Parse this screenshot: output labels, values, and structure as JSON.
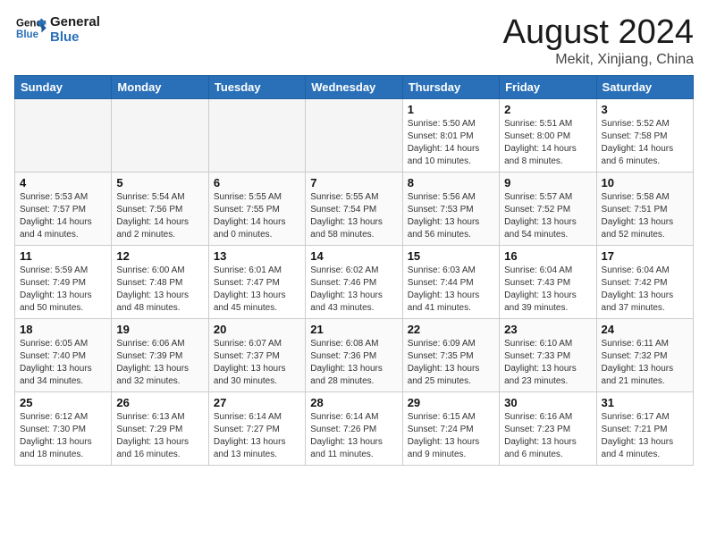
{
  "logo": {
    "line1": "General",
    "line2": "Blue"
  },
  "title": "August 2024",
  "subtitle": "Mekit, Xinjiang, China",
  "headers": [
    "Sunday",
    "Monday",
    "Tuesday",
    "Wednesday",
    "Thursday",
    "Friday",
    "Saturday"
  ],
  "weeks": [
    [
      {
        "day": "",
        "info": ""
      },
      {
        "day": "",
        "info": ""
      },
      {
        "day": "",
        "info": ""
      },
      {
        "day": "",
        "info": ""
      },
      {
        "day": "1",
        "info": "Sunrise: 5:50 AM\nSunset: 8:01 PM\nDaylight: 14 hours\nand 10 minutes."
      },
      {
        "day": "2",
        "info": "Sunrise: 5:51 AM\nSunset: 8:00 PM\nDaylight: 14 hours\nand 8 minutes."
      },
      {
        "day": "3",
        "info": "Sunrise: 5:52 AM\nSunset: 7:58 PM\nDaylight: 14 hours\nand 6 minutes."
      }
    ],
    [
      {
        "day": "4",
        "info": "Sunrise: 5:53 AM\nSunset: 7:57 PM\nDaylight: 14 hours\nand 4 minutes."
      },
      {
        "day": "5",
        "info": "Sunrise: 5:54 AM\nSunset: 7:56 PM\nDaylight: 14 hours\nand 2 minutes."
      },
      {
        "day": "6",
        "info": "Sunrise: 5:55 AM\nSunset: 7:55 PM\nDaylight: 14 hours\nand 0 minutes."
      },
      {
        "day": "7",
        "info": "Sunrise: 5:55 AM\nSunset: 7:54 PM\nDaylight: 13 hours\nand 58 minutes."
      },
      {
        "day": "8",
        "info": "Sunrise: 5:56 AM\nSunset: 7:53 PM\nDaylight: 13 hours\nand 56 minutes."
      },
      {
        "day": "9",
        "info": "Sunrise: 5:57 AM\nSunset: 7:52 PM\nDaylight: 13 hours\nand 54 minutes."
      },
      {
        "day": "10",
        "info": "Sunrise: 5:58 AM\nSunset: 7:51 PM\nDaylight: 13 hours\nand 52 minutes."
      }
    ],
    [
      {
        "day": "11",
        "info": "Sunrise: 5:59 AM\nSunset: 7:49 PM\nDaylight: 13 hours\nand 50 minutes."
      },
      {
        "day": "12",
        "info": "Sunrise: 6:00 AM\nSunset: 7:48 PM\nDaylight: 13 hours\nand 48 minutes."
      },
      {
        "day": "13",
        "info": "Sunrise: 6:01 AM\nSunset: 7:47 PM\nDaylight: 13 hours\nand 45 minutes."
      },
      {
        "day": "14",
        "info": "Sunrise: 6:02 AM\nSunset: 7:46 PM\nDaylight: 13 hours\nand 43 minutes."
      },
      {
        "day": "15",
        "info": "Sunrise: 6:03 AM\nSunset: 7:44 PM\nDaylight: 13 hours\nand 41 minutes."
      },
      {
        "day": "16",
        "info": "Sunrise: 6:04 AM\nSunset: 7:43 PM\nDaylight: 13 hours\nand 39 minutes."
      },
      {
        "day": "17",
        "info": "Sunrise: 6:04 AM\nSunset: 7:42 PM\nDaylight: 13 hours\nand 37 minutes."
      }
    ],
    [
      {
        "day": "18",
        "info": "Sunrise: 6:05 AM\nSunset: 7:40 PM\nDaylight: 13 hours\nand 34 minutes."
      },
      {
        "day": "19",
        "info": "Sunrise: 6:06 AM\nSunset: 7:39 PM\nDaylight: 13 hours\nand 32 minutes."
      },
      {
        "day": "20",
        "info": "Sunrise: 6:07 AM\nSunset: 7:37 PM\nDaylight: 13 hours\nand 30 minutes."
      },
      {
        "day": "21",
        "info": "Sunrise: 6:08 AM\nSunset: 7:36 PM\nDaylight: 13 hours\nand 28 minutes."
      },
      {
        "day": "22",
        "info": "Sunrise: 6:09 AM\nSunset: 7:35 PM\nDaylight: 13 hours\nand 25 minutes."
      },
      {
        "day": "23",
        "info": "Sunrise: 6:10 AM\nSunset: 7:33 PM\nDaylight: 13 hours\nand 23 minutes."
      },
      {
        "day": "24",
        "info": "Sunrise: 6:11 AM\nSunset: 7:32 PM\nDaylight: 13 hours\nand 21 minutes."
      }
    ],
    [
      {
        "day": "25",
        "info": "Sunrise: 6:12 AM\nSunset: 7:30 PM\nDaylight: 13 hours\nand 18 minutes."
      },
      {
        "day": "26",
        "info": "Sunrise: 6:13 AM\nSunset: 7:29 PM\nDaylight: 13 hours\nand 16 minutes."
      },
      {
        "day": "27",
        "info": "Sunrise: 6:14 AM\nSunset: 7:27 PM\nDaylight: 13 hours\nand 13 minutes."
      },
      {
        "day": "28",
        "info": "Sunrise: 6:14 AM\nSunset: 7:26 PM\nDaylight: 13 hours\nand 11 minutes."
      },
      {
        "day": "29",
        "info": "Sunrise: 6:15 AM\nSunset: 7:24 PM\nDaylight: 13 hours\nand 9 minutes."
      },
      {
        "day": "30",
        "info": "Sunrise: 6:16 AM\nSunset: 7:23 PM\nDaylight: 13 hours\nand 6 minutes."
      },
      {
        "day": "31",
        "info": "Sunrise: 6:17 AM\nSunset: 7:21 PM\nDaylight: 13 hours\nand 4 minutes."
      }
    ]
  ]
}
